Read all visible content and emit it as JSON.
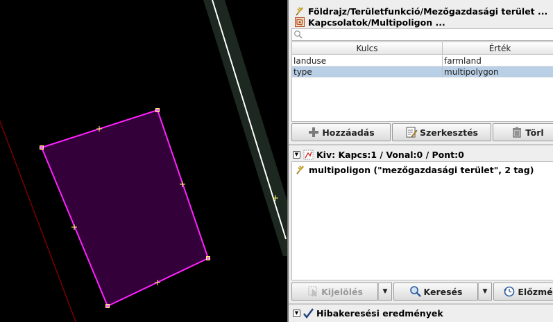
{
  "presets": [
    {
      "label": "Földrajz/Területfunkció/Mezőgazdasági terület ...",
      "icon": "farmland-icon"
    },
    {
      "label": "Kapcsolatok/Multipoligon ...",
      "icon": "multipolygon-relation-icon"
    }
  ],
  "tag_table": {
    "headers": [
      "Kulcs",
      "Érték"
    ],
    "rows": [
      {
        "key": "landuse",
        "value": "farmland"
      },
      {
        "key": "type",
        "value": "multipolygon"
      }
    ]
  },
  "tag_buttons": {
    "add": "Hozzáadás",
    "edit": "Szerkesztés",
    "delete": "Törl"
  },
  "selection": {
    "title": "Kiv: Kapcs:1 / Vonal:0 / Pont:0",
    "item": "multipoligon (\"mezőgazdasági terület\", 2 tag)"
  },
  "selection_buttons": {
    "select": "Kijelölés",
    "search": "Keresés",
    "history": "Előzmé"
  },
  "validation": {
    "title": "Hibakeresési eredmények"
  },
  "colors": {
    "polygon_fill": "#33003a",
    "polygon_stroke": "#ff22ff",
    "node": "#ffff66",
    "road_casing": "#1f2a22",
    "road_line": "#ffffff",
    "selected_row": "#b8cfe5"
  }
}
